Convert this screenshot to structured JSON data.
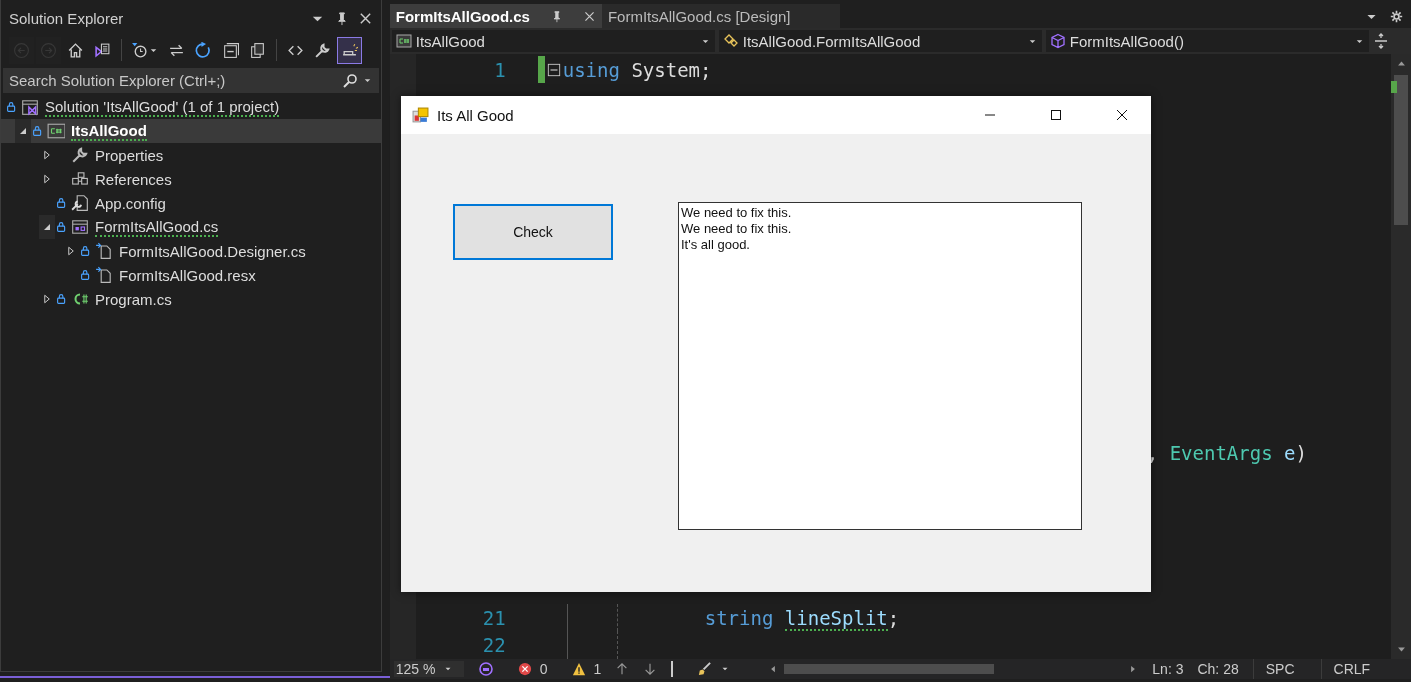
{
  "solution_explorer": {
    "title": "Solution Explorer",
    "header_buttons": [
      {
        "kind": "dropdown"
      },
      {
        "kind": "pin"
      },
      {
        "kind": "close"
      }
    ],
    "toolbar_groups": [
      [
        {
          "kind": "back",
          "disabled": true,
          "selected": false
        },
        {
          "kind": "forward",
          "disabled": true,
          "selected": false
        },
        {
          "kind": "home",
          "disabled": false,
          "selected": false
        },
        {
          "kind": "switch-views",
          "disabled": false,
          "selected": false
        }
      ],
      [
        {
          "kind": "history",
          "disabled": false,
          "selected": false
        },
        {
          "kind": "sync",
          "disabled": false,
          "selected": false
        },
        {
          "kind": "refresh",
          "disabled": false,
          "selected": false
        },
        {
          "kind": "collapse",
          "disabled": false,
          "selected": false
        },
        {
          "kind": "copy",
          "disabled": false,
          "selected": false
        }
      ],
      [
        {
          "kind": "code",
          "disabled": false,
          "selected": false
        },
        {
          "kind": "wrench",
          "disabled": false,
          "selected": false
        },
        {
          "kind": "preview",
          "disabled": false,
          "selected": true
        }
      ]
    ],
    "search": {
      "placeholder": "Search Solution Explorer (Ctrl+;)"
    },
    "tree": [
      {
        "label": "Solution 'ItsAllGood' (1 of 1 project)",
        "kind": "solution",
        "locked": true,
        "expandable": false,
        "expanded": false,
        "selected": false,
        "warning": true,
        "children": [
          {
            "label": "ItsAllGood",
            "kind": "csproject",
            "locked": true,
            "expandable": true,
            "expanded": true,
            "selected": true,
            "warning": true,
            "children": [
              {
                "label": "Properties",
                "kind": "properties",
                "locked": false,
                "expandable": true,
                "expanded": false,
                "selected": false,
                "warning": false
              },
              {
                "label": "References",
                "kind": "references",
                "locked": false,
                "expandable": true,
                "expanded": false,
                "selected": false,
                "warning": false
              },
              {
                "label": "App.config",
                "kind": "config",
                "locked": true,
                "expandable": false,
                "expanded": false,
                "selected": false,
                "warning": false
              },
              {
                "label": "FormItsAllGood.cs",
                "kind": "form",
                "locked": true,
                "expandable": true,
                "expanded": true,
                "selected": false,
                "warning": true,
                "children": [
                  {
                    "label": "FormItsAllGood.Designer.cs",
                    "kind": "file",
                    "locked": true,
                    "expandable": true,
                    "expanded": false,
                    "selected": false,
                    "warning": false
                  },
                  {
                    "label": "FormItsAllGood.resx",
                    "kind": "file",
                    "locked": true,
                    "expandable": false,
                    "expanded": false,
                    "selected": false,
                    "warning": false
                  }
                ]
              },
              {
                "label": "Program.cs",
                "kind": "csfile",
                "locked": true,
                "expandable": true,
                "expanded": false,
                "selected": false,
                "warning": false
              }
            ]
          }
        ]
      }
    ]
  },
  "editor": {
    "tabs": [
      {
        "label": "FormItsAllGood.cs",
        "selected": true
      },
      {
        "label": "FormItsAllGood.cs [Design]",
        "selected": false
      }
    ],
    "navigation": [
      {
        "kind": "project",
        "text": "ItsAllGood"
      },
      {
        "kind": "class",
        "text": "ItsAllGood.FormItsAllGood"
      },
      {
        "kind": "member",
        "text": "FormItsAllGood()"
      }
    ],
    "code_rows": [
      {
        "kind": "top",
        "number": "1",
        "tokens": [
          {
            "kind": "keyword",
            "text": "using",
            "warning": false
          },
          {
            "kind": "plain",
            "text": " System;",
            "warning": false
          }
        ]
      },
      {
        "kind": "covered"
      },
      {
        "kind": "covered"
      },
      {
        "kind": "covered"
      },
      {
        "kind": "covered"
      },
      {
        "kind": "covered"
      },
      {
        "kind": "covered"
      },
      {
        "kind": "covered"
      },
      {
        "kind": "covered"
      },
      {
        "kind": "covered"
      },
      {
        "kind": "covered"
      },
      {
        "kind": "covered"
      },
      {
        "kind": "covered"
      },
      {
        "kind": "covered"
      },
      {
        "kind": "tail",
        "tokens": [
          {
            "kind": "plain",
            "text": ", ",
            "warning": false
          },
          {
            "kind": "type",
            "text": "EventArgs ",
            "warning": false
          },
          {
            "kind": "param",
            "text": "e",
            "warning": false
          },
          {
            "kind": "plain",
            "text": ")",
            "warning": false
          }
        ]
      },
      {
        "kind": "covered"
      },
      {
        "kind": "covered"
      },
      {
        "kind": "covered"
      },
      {
        "kind": "covered"
      },
      {
        "kind": "covered"
      },
      {
        "kind": "nested",
        "number": "21",
        "tokens": [
          {
            "kind": "keyword",
            "text": "string ",
            "warning": false
          },
          {
            "kind": "param",
            "text": "lineSplit",
            "warning": true
          },
          {
            "kind": "plain",
            "text": ";",
            "warning": false
          }
        ]
      },
      {
        "kind": "nested",
        "number": "22",
        "tokens": []
      }
    ]
  },
  "status_bar": {
    "zoom": "125 %",
    "errors": "0",
    "warnings": "1",
    "line": "Ln: 3",
    "column": "Ch: 28",
    "indentation": "SPC",
    "line_ending": "CRLF"
  },
  "form_window": {
    "title": "Its All Good",
    "button": {
      "label": "Check",
      "focused": true
    },
    "output": {
      "lines": [
        "We need to fix this.",
        "We need to fix this.",
        "It's all good."
      ]
    }
  }
}
